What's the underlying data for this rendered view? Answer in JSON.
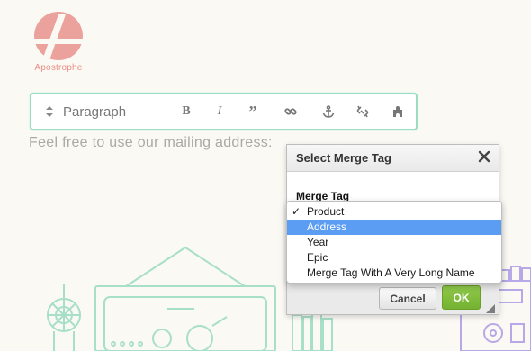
{
  "app": {
    "logo_text": "Apostrophe",
    "logo_color": "#e98e86"
  },
  "toolbar": {
    "style_value": "Paragraph",
    "bold_label": "B",
    "italic_label": "I",
    "quote_label": "”",
    "icons": [
      "style-arrows-icon",
      "link-icon",
      "anchor-icon",
      "unlink-icon",
      "plugin-icon"
    ],
    "border_color": "#9bdcc3"
  },
  "content": {
    "body_text": "Feel free to use our mailing address:"
  },
  "dialog": {
    "title": "Select Merge Tag",
    "field_label": "Merge Tag",
    "cancel_label": "Cancel",
    "ok_label": "OK",
    "ok_color": "#7ab936"
  },
  "dropdown": {
    "checked_value": "Product",
    "highlighted_value": "Address",
    "highlight_color": "#5b9df2",
    "options": [
      {
        "label": "Product"
      },
      {
        "label": "Address"
      },
      {
        "label": "Year"
      },
      {
        "label": "Epic"
      },
      {
        "label": "Merge Tag With A Very Long Name"
      }
    ]
  },
  "illustration": {
    "line_color": "#a8dfc9",
    "accent_color": "#b7a9e8"
  }
}
